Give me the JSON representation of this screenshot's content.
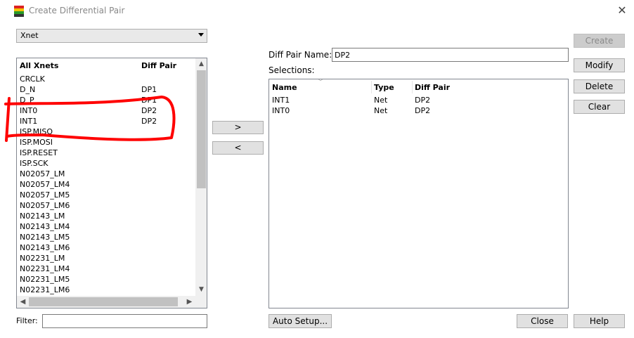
{
  "window": {
    "title": "Create Differential Pair"
  },
  "filter_type": {
    "selected": "Xnet"
  },
  "xnet_list": {
    "headers": {
      "name": "All Xnets",
      "diff": "Diff Pair"
    },
    "rows": [
      {
        "name": "CRCLK",
        "diff": ""
      },
      {
        "name": "D_N",
        "diff": "DP1"
      },
      {
        "name": "D_P",
        "diff": "DP1"
      },
      {
        "name": "INT0",
        "diff": "DP2"
      },
      {
        "name": "INT1",
        "diff": "DP2"
      },
      {
        "name": "ISP.MISO",
        "diff": ""
      },
      {
        "name": "ISP.MOSI",
        "diff": ""
      },
      {
        "name": "ISP.RESET",
        "diff": ""
      },
      {
        "name": "ISP.SCK",
        "diff": ""
      },
      {
        "name": "N02057_LM",
        "diff": ""
      },
      {
        "name": "N02057_LM4",
        "diff": ""
      },
      {
        "name": "N02057_LM5",
        "diff": ""
      },
      {
        "name": "N02057_LM6",
        "diff": ""
      },
      {
        "name": "N02143_LM",
        "diff": ""
      },
      {
        "name": "N02143_LM4",
        "diff": ""
      },
      {
        "name": "N02143_LM5",
        "diff": ""
      },
      {
        "name": "N02143_LM6",
        "diff": ""
      },
      {
        "name": "N02231_LM",
        "diff": ""
      },
      {
        "name": "N02231_LM4",
        "diff": ""
      },
      {
        "name": "N02231_LM5",
        "diff": ""
      },
      {
        "name": "N02231_LM6",
        "diff": ""
      }
    ]
  },
  "filter": {
    "label": "Filter:",
    "value": ""
  },
  "move": {
    "add_label": ">",
    "remove_label": "<"
  },
  "diff_pair_name": {
    "label": "Diff Pair Name:",
    "value": "DP2"
  },
  "selections": {
    "label": "Selections:",
    "headers": {
      "name": "Name",
      "type": "Type",
      "diff": "Diff Pair"
    },
    "rows": [
      {
        "name": "INT1",
        "type": "Net",
        "diff": "DP2"
      },
      {
        "name": "INT0",
        "type": "Net",
        "diff": "DP2"
      }
    ]
  },
  "buttons": {
    "create": "Create",
    "modify": "Modify",
    "delete": "Delete",
    "clear": "Clear",
    "auto_setup": "Auto Setup...",
    "close": "Close",
    "help": "Help"
  },
  "colors": {
    "annotation": "#ff0000",
    "disabled_button": "#cccccc"
  }
}
